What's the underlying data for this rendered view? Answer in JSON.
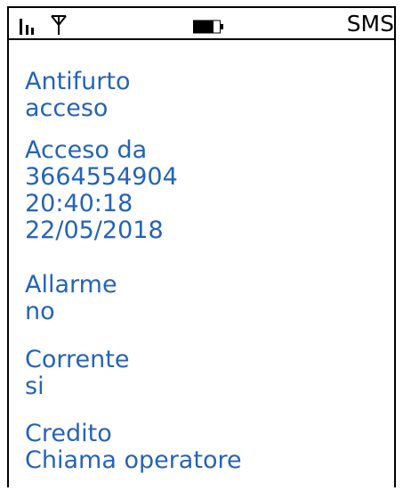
{
  "status_bar": {
    "signal_icon": "signal-bars-icon",
    "antenna_icon": "antenna-icon",
    "battery_icon": "battery-icon",
    "battery_level": 0.75,
    "label": "SMS"
  },
  "colors": {
    "text": "#2563b8",
    "frame": "#000000"
  },
  "fields": {
    "antifurto": {
      "label": "Antifurto",
      "value": "acceso"
    },
    "acceso_da": {
      "label": "Acceso da",
      "number": "3664554904",
      "time": "20:40:18",
      "date": "22/05/2018"
    },
    "allarme": {
      "label": "Allarme",
      "value": "no"
    },
    "corrente": {
      "label": "Corrente",
      "value": "si"
    },
    "credito": {
      "label": "Credito",
      "value": "Chiama operatore"
    }
  }
}
